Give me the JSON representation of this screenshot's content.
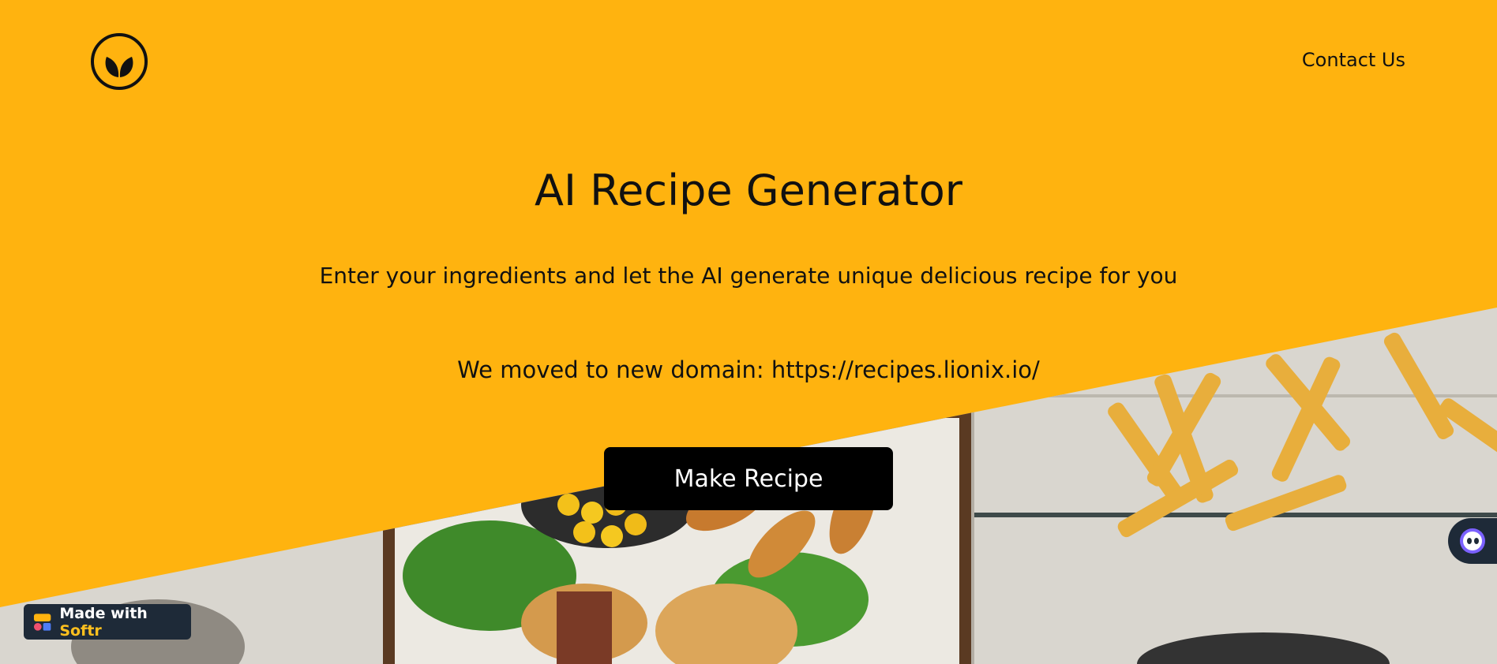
{
  "nav": {
    "logo_icon": "leaf-logo-icon",
    "contact_label": "Contact Us"
  },
  "hero": {
    "title": "AI Recipe Generator",
    "subtitle": "Enter your ingredients and let the AI generate unique delicious recipe for you",
    "domain_notice": "We moved to new domain: https://recipes.lionix.io/",
    "cta_label": "Make Recipe"
  },
  "badge": {
    "prefix": "Made with ",
    "brand": "Softr"
  },
  "chat": {
    "icon": "chat-bot-icon"
  },
  "colors": {
    "background": "#FFB30F",
    "button": "#000000",
    "badge_bg": "#1E2A38",
    "badge_brand": "#FFC01E"
  }
}
